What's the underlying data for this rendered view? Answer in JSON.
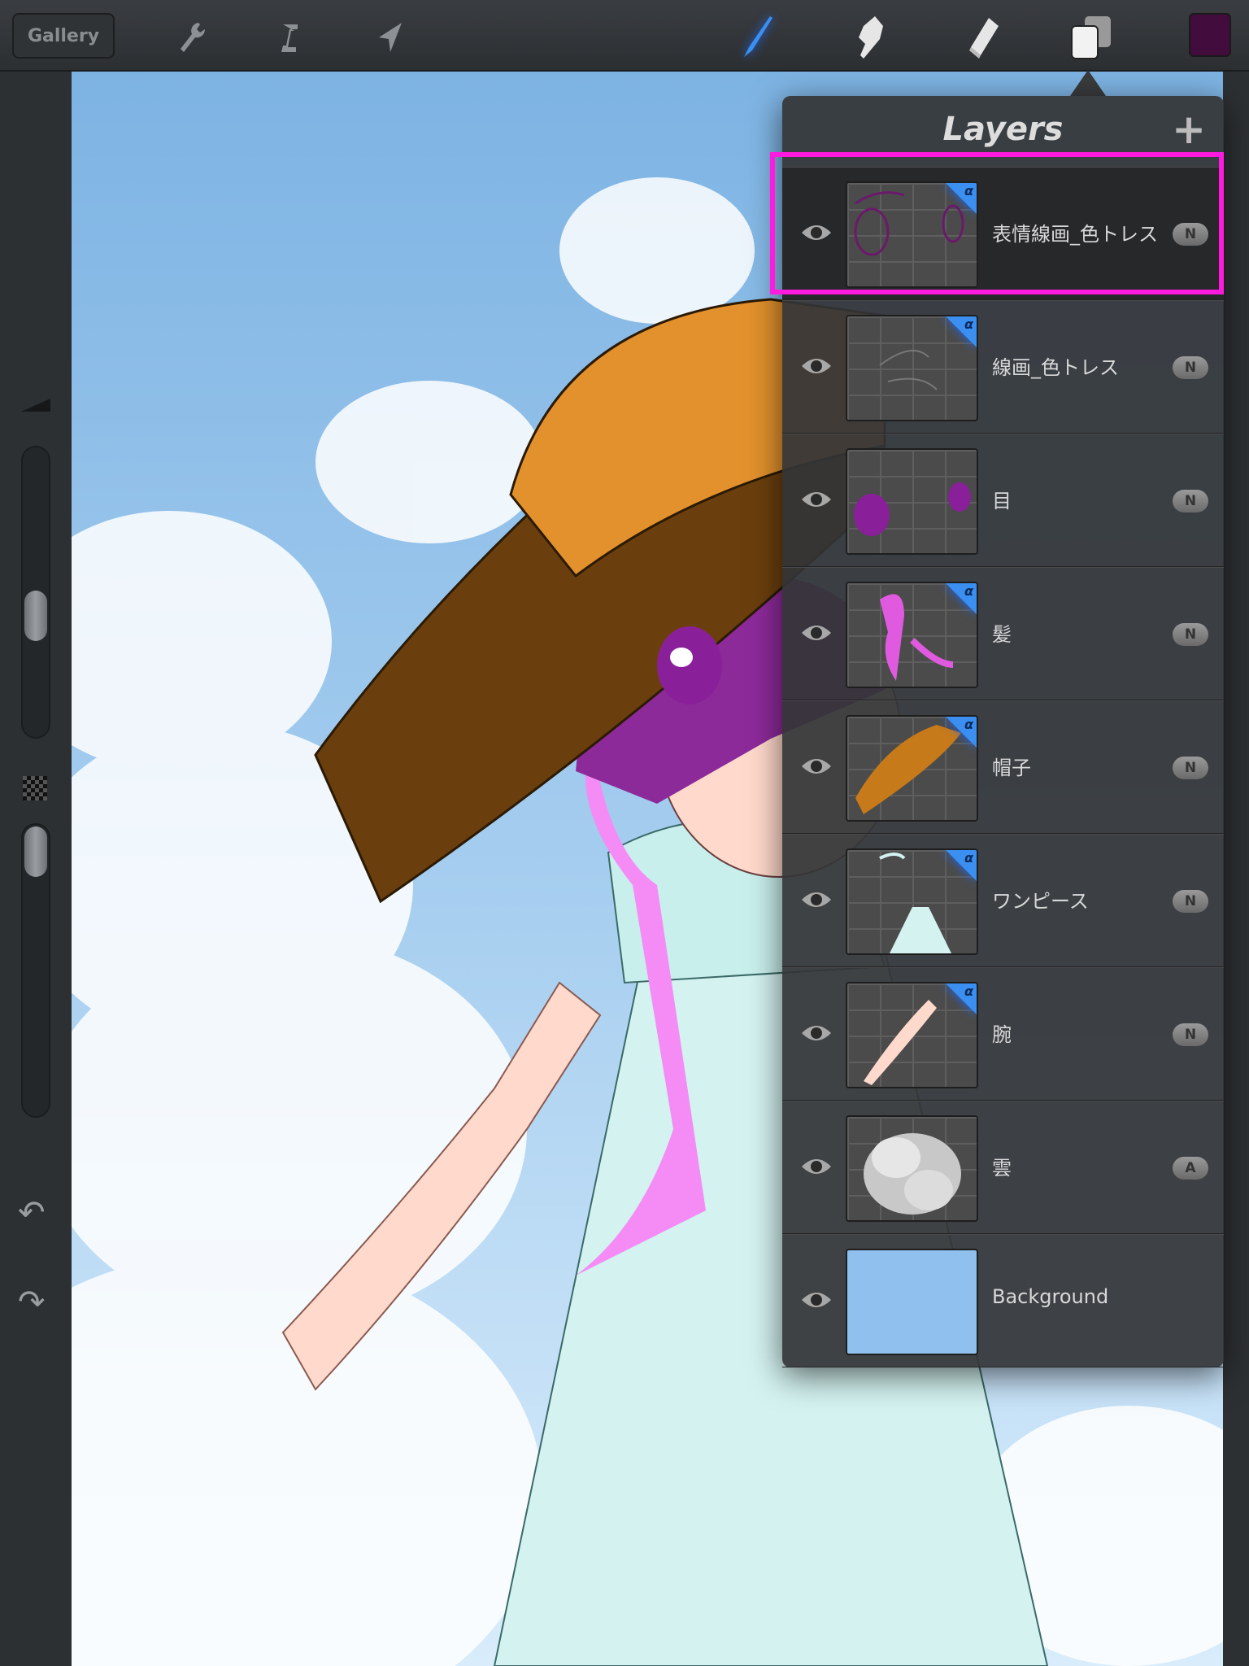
{
  "toolbar": {
    "gallery_label": "Gallery",
    "tools": [
      "wrench-icon",
      "adjust-icon",
      "transform-arrow-icon",
      "brush-icon",
      "smudge-icon",
      "eraser-icon",
      "layers-icon"
    ],
    "active_tool": "brush-icon",
    "current_color": "#420c3d",
    "accent": "#3a8ff0"
  },
  "layers_panel": {
    "title": "Layers",
    "add_label": "+",
    "layers": [
      {
        "name": "表情線画_色トレス",
        "blend": "N",
        "alpha_lock": true,
        "selected": true
      },
      {
        "name": "線画_色トレス",
        "blend": "N",
        "alpha_lock": true
      },
      {
        "name": "目",
        "blend": "N",
        "alpha_lock": false
      },
      {
        "name": "髪",
        "blend": "N",
        "alpha_lock": true
      },
      {
        "name": "帽子",
        "blend": "N",
        "alpha_lock": true
      },
      {
        "name": "ワンピース",
        "blend": "N",
        "alpha_lock": true
      },
      {
        "name": "腕",
        "blend": "N",
        "alpha_lock": true
      },
      {
        "name": "雲",
        "blend": "A",
        "alpha_lock": false
      },
      {
        "name": "Background",
        "blend": "",
        "alpha_lock": false,
        "color": "#8fc0ee"
      }
    ],
    "alpha_symbol": "α",
    "highlight_color": "#ff1ae0"
  }
}
